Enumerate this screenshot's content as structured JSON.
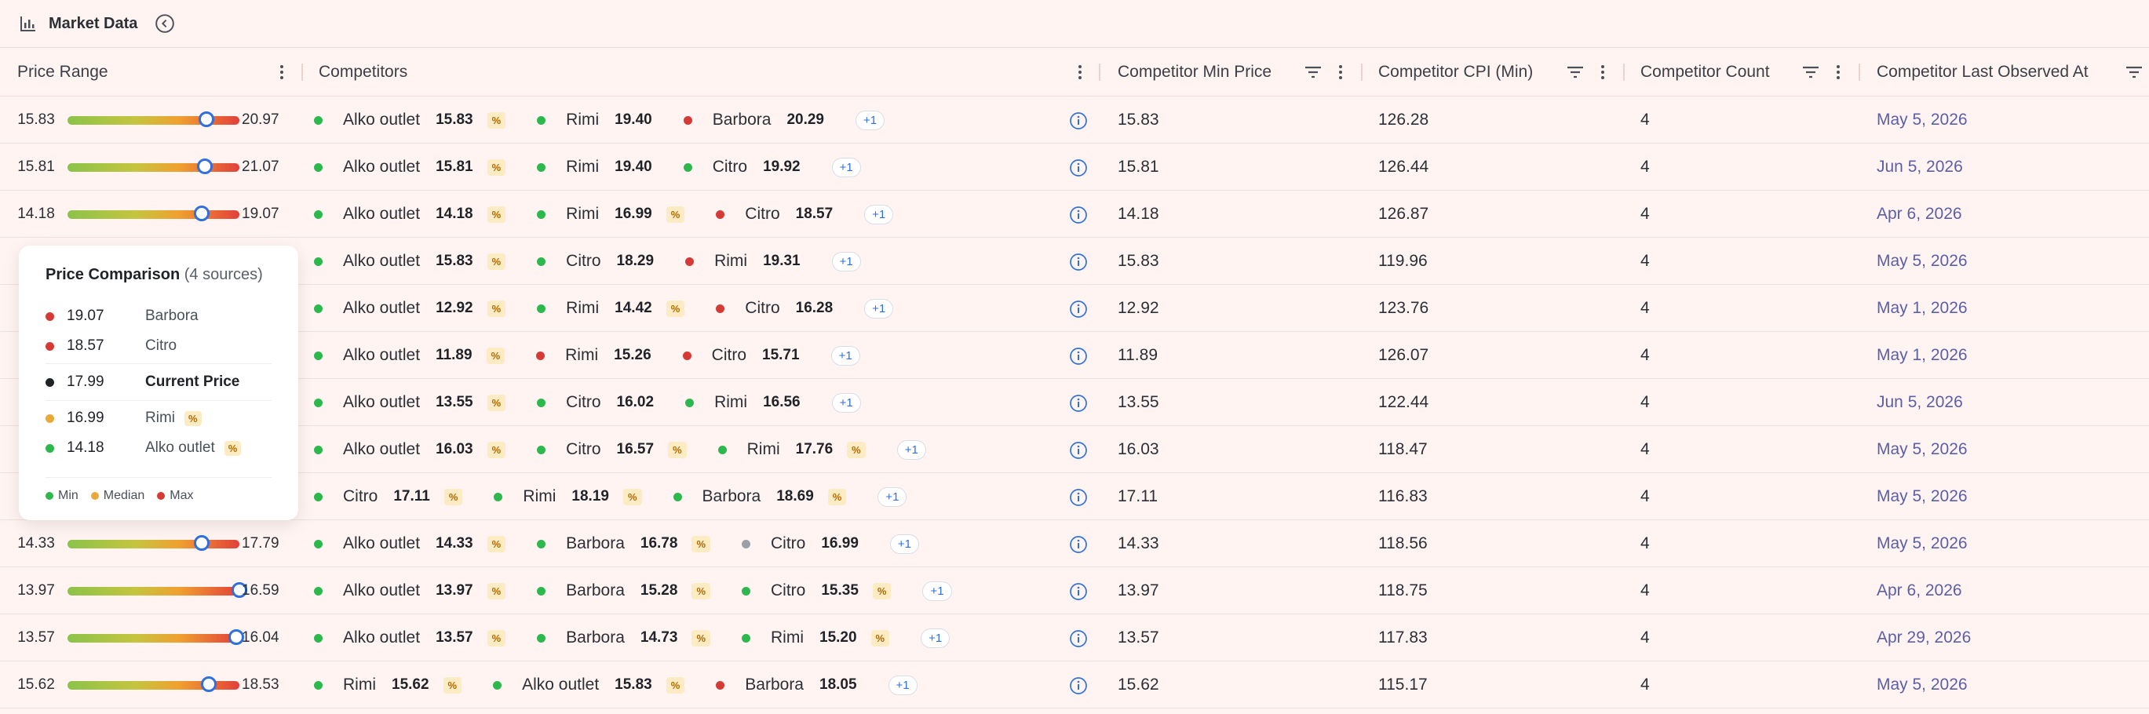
{
  "header": {
    "title": "Market Data"
  },
  "columns": {
    "price_range": "Price Range",
    "competitors": "Competitors",
    "min_price": "Competitor Min Price",
    "cpi": "Competitor CPI (Min)",
    "count": "Competitor Count",
    "last_observed": "Competitor Last Observed At"
  },
  "colors": {
    "green": "#2db84d",
    "red": "#d63a36",
    "gray": "#9aa0a6",
    "accent": "#2f6fe0"
  },
  "rows": [
    {
      "min": "15.83",
      "max": "20.97",
      "pos": 0.81,
      "show_range": true,
      "comps": [
        {
          "name": "Alko outlet",
          "val": "15.83",
          "c": "green",
          "pct": true
        },
        {
          "name": "Rimi",
          "val": "19.40",
          "c": "green",
          "pct": false
        },
        {
          "name": "Barbora",
          "val": "20.29",
          "c": "red",
          "pct": false
        }
      ],
      "more": "+1",
      "minp": "15.83",
      "cpi": "126.28",
      "count": "4",
      "date": "May 5, 2026"
    },
    {
      "min": "15.81",
      "max": "21.07",
      "pos": 0.8,
      "show_range": true,
      "comps": [
        {
          "name": "Alko outlet",
          "val": "15.81",
          "c": "green",
          "pct": true
        },
        {
          "name": "Rimi",
          "val": "19.40",
          "c": "green",
          "pct": false
        },
        {
          "name": "Citro",
          "val": "19.92",
          "c": "green",
          "pct": false
        }
      ],
      "more": "+1",
      "minp": "15.81",
      "cpi": "126.44",
      "count": "4",
      "date": "Jun 5, 2026"
    },
    {
      "min": "14.18",
      "max": "19.07",
      "pos": 0.78,
      "show_range": true,
      "comps": [
        {
          "name": "Alko outlet",
          "val": "14.18",
          "c": "green",
          "pct": true
        },
        {
          "name": "Rimi",
          "val": "16.99",
          "c": "green",
          "pct": true
        },
        {
          "name": "Citro",
          "val": "18.57",
          "c": "red",
          "pct": false
        }
      ],
      "more": "+1",
      "minp": "14.18",
      "cpi": "126.87",
      "count": "4",
      "date": "Apr 6, 2026"
    },
    {
      "min": "",
      "max": "",
      "pos": 0,
      "show_range": false,
      "comps": [
        {
          "name": "Alko outlet",
          "val": "15.83",
          "c": "green",
          "pct": true
        },
        {
          "name": "Citro",
          "val": "18.29",
          "c": "green",
          "pct": false
        },
        {
          "name": "Rimi",
          "val": "19.31",
          "c": "red",
          "pct": false
        }
      ],
      "more": "+1",
      "minp": "15.83",
      "cpi": "119.96",
      "count": "4",
      "date": "May 5, 2026"
    },
    {
      "min": "",
      "max": "",
      "pos": 0,
      "show_range": false,
      "comps": [
        {
          "name": "Alko outlet",
          "val": "12.92",
          "c": "green",
          "pct": true
        },
        {
          "name": "Rimi",
          "val": "14.42",
          "c": "green",
          "pct": true
        },
        {
          "name": "Citro",
          "val": "16.28",
          "c": "red",
          "pct": false
        }
      ],
      "more": "+1",
      "minp": "12.92",
      "cpi": "123.76",
      "count": "4",
      "date": "May 1, 2026"
    },
    {
      "min": "",
      "max": "",
      "pos": 0,
      "show_range": false,
      "comps": [
        {
          "name": "Alko outlet",
          "val": "11.89",
          "c": "green",
          "pct": true
        },
        {
          "name": "Rimi",
          "val": "15.26",
          "c": "red",
          "pct": false
        },
        {
          "name": "Citro",
          "val": "15.71",
          "c": "red",
          "pct": false
        }
      ],
      "more": "+1",
      "minp": "11.89",
      "cpi": "126.07",
      "count": "4",
      "date": "May 1, 2026"
    },
    {
      "min": "",
      "max": "",
      "pos": 0,
      "show_range": false,
      "comps": [
        {
          "name": "Alko outlet",
          "val": "13.55",
          "c": "green",
          "pct": true
        },
        {
          "name": "Citro",
          "val": "16.02",
          "c": "green",
          "pct": false
        },
        {
          "name": "Rimi",
          "val": "16.56",
          "c": "green",
          "pct": false
        }
      ],
      "more": "+1",
      "minp": "13.55",
      "cpi": "122.44",
      "count": "4",
      "date": "Jun 5, 2026"
    },
    {
      "min": "",
      "max": "",
      "pos": 0,
      "show_range": false,
      "comps": [
        {
          "name": "Alko outlet",
          "val": "16.03",
          "c": "green",
          "pct": true
        },
        {
          "name": "Citro",
          "val": "16.57",
          "c": "green",
          "pct": true
        },
        {
          "name": "Rimi",
          "val": "17.76",
          "c": "green",
          "pct": true
        }
      ],
      "more": "+1",
      "minp": "16.03",
      "cpi": "118.47",
      "count": "4",
      "date": "May 5, 2026"
    },
    {
      "min": "",
      "max": "",
      "pos": 0,
      "show_range": false,
      "comps": [
        {
          "name": "Citro",
          "val": "17.11",
          "c": "green",
          "pct": true
        },
        {
          "name": "Rimi",
          "val": "18.19",
          "c": "green",
          "pct": true
        },
        {
          "name": "Barbora",
          "val": "18.69",
          "c": "green",
          "pct": true
        }
      ],
      "more": "+1",
      "minp": "17.11",
      "cpi": "116.83",
      "count": "4",
      "date": "May 5, 2026"
    },
    {
      "min": "14.33",
      "max": "17.79",
      "pos": 0.78,
      "show_range": true,
      "comps": [
        {
          "name": "Alko outlet",
          "val": "14.33",
          "c": "green",
          "pct": true
        },
        {
          "name": "Barbora",
          "val": "16.78",
          "c": "green",
          "pct": true
        },
        {
          "name": "Citro",
          "val": "16.99",
          "c": "gray",
          "pct": false
        }
      ],
      "more": "+1",
      "minp": "14.33",
      "cpi": "118.56",
      "count": "4",
      "date": "May 5, 2026"
    },
    {
      "min": "13.97",
      "max": "16.59",
      "pos": 1.0,
      "show_range": true,
      "comps": [
        {
          "name": "Alko outlet",
          "val": "13.97",
          "c": "green",
          "pct": true
        },
        {
          "name": "Barbora",
          "val": "15.28",
          "c": "green",
          "pct": true
        },
        {
          "name": "Citro",
          "val": "15.35",
          "c": "green",
          "pct": true
        }
      ],
      "more": "+1",
      "minp": "13.97",
      "cpi": "118.75",
      "count": "4",
      "date": "Apr 6, 2026"
    },
    {
      "min": "13.57",
      "max": "16.04",
      "pos": 0.98,
      "show_range": true,
      "comps": [
        {
          "name": "Alko outlet",
          "val": "13.57",
          "c": "green",
          "pct": true
        },
        {
          "name": "Barbora",
          "val": "14.73",
          "c": "green",
          "pct": true
        },
        {
          "name": "Rimi",
          "val": "15.20",
          "c": "green",
          "pct": true
        }
      ],
      "more": "+1",
      "minp": "13.57",
      "cpi": "117.83",
      "count": "4",
      "date": "Apr 29, 2026"
    },
    {
      "min": "15.62",
      "max": "18.53",
      "pos": 0.82,
      "show_range": true,
      "comps": [
        {
          "name": "Rimi",
          "val": "15.62",
          "c": "green",
          "pct": true
        },
        {
          "name": "Alko outlet",
          "val": "15.83",
          "c": "green",
          "pct": true
        },
        {
          "name": "Barbora",
          "val": "18.05",
          "c": "red",
          "pct": false
        }
      ],
      "more": "+1",
      "minp": "15.62",
      "cpi": "115.17",
      "count": "4",
      "date": "May 5, 2026"
    }
  ],
  "tooltip": {
    "title": "Price Comparison",
    "subtitle": "(4 sources)",
    "entries": [
      {
        "val": "19.07",
        "name": "Barbora",
        "color": "#d63a36",
        "pct": false,
        "current": false
      },
      {
        "val": "18.57",
        "name": "Citro",
        "color": "#d63a36",
        "pct": false,
        "current": false
      },
      {
        "val": "17.99",
        "name": "Current Price",
        "color": "#1f2328",
        "pct": false,
        "current": true
      },
      {
        "val": "16.99",
        "name": "Rimi",
        "color": "#e8a93a",
        "pct": true,
        "current": false
      },
      {
        "val": "14.18",
        "name": "Alko outlet",
        "color": "#2db84d",
        "pct": true,
        "current": false
      }
    ],
    "legend": [
      {
        "label": "Min",
        "color": "#2db84d"
      },
      {
        "label": "Median",
        "color": "#e8a93a"
      },
      {
        "label": "Max",
        "color": "#d63a36"
      }
    ],
    "pct_label": "%"
  },
  "badges": {
    "pct": "%"
  }
}
